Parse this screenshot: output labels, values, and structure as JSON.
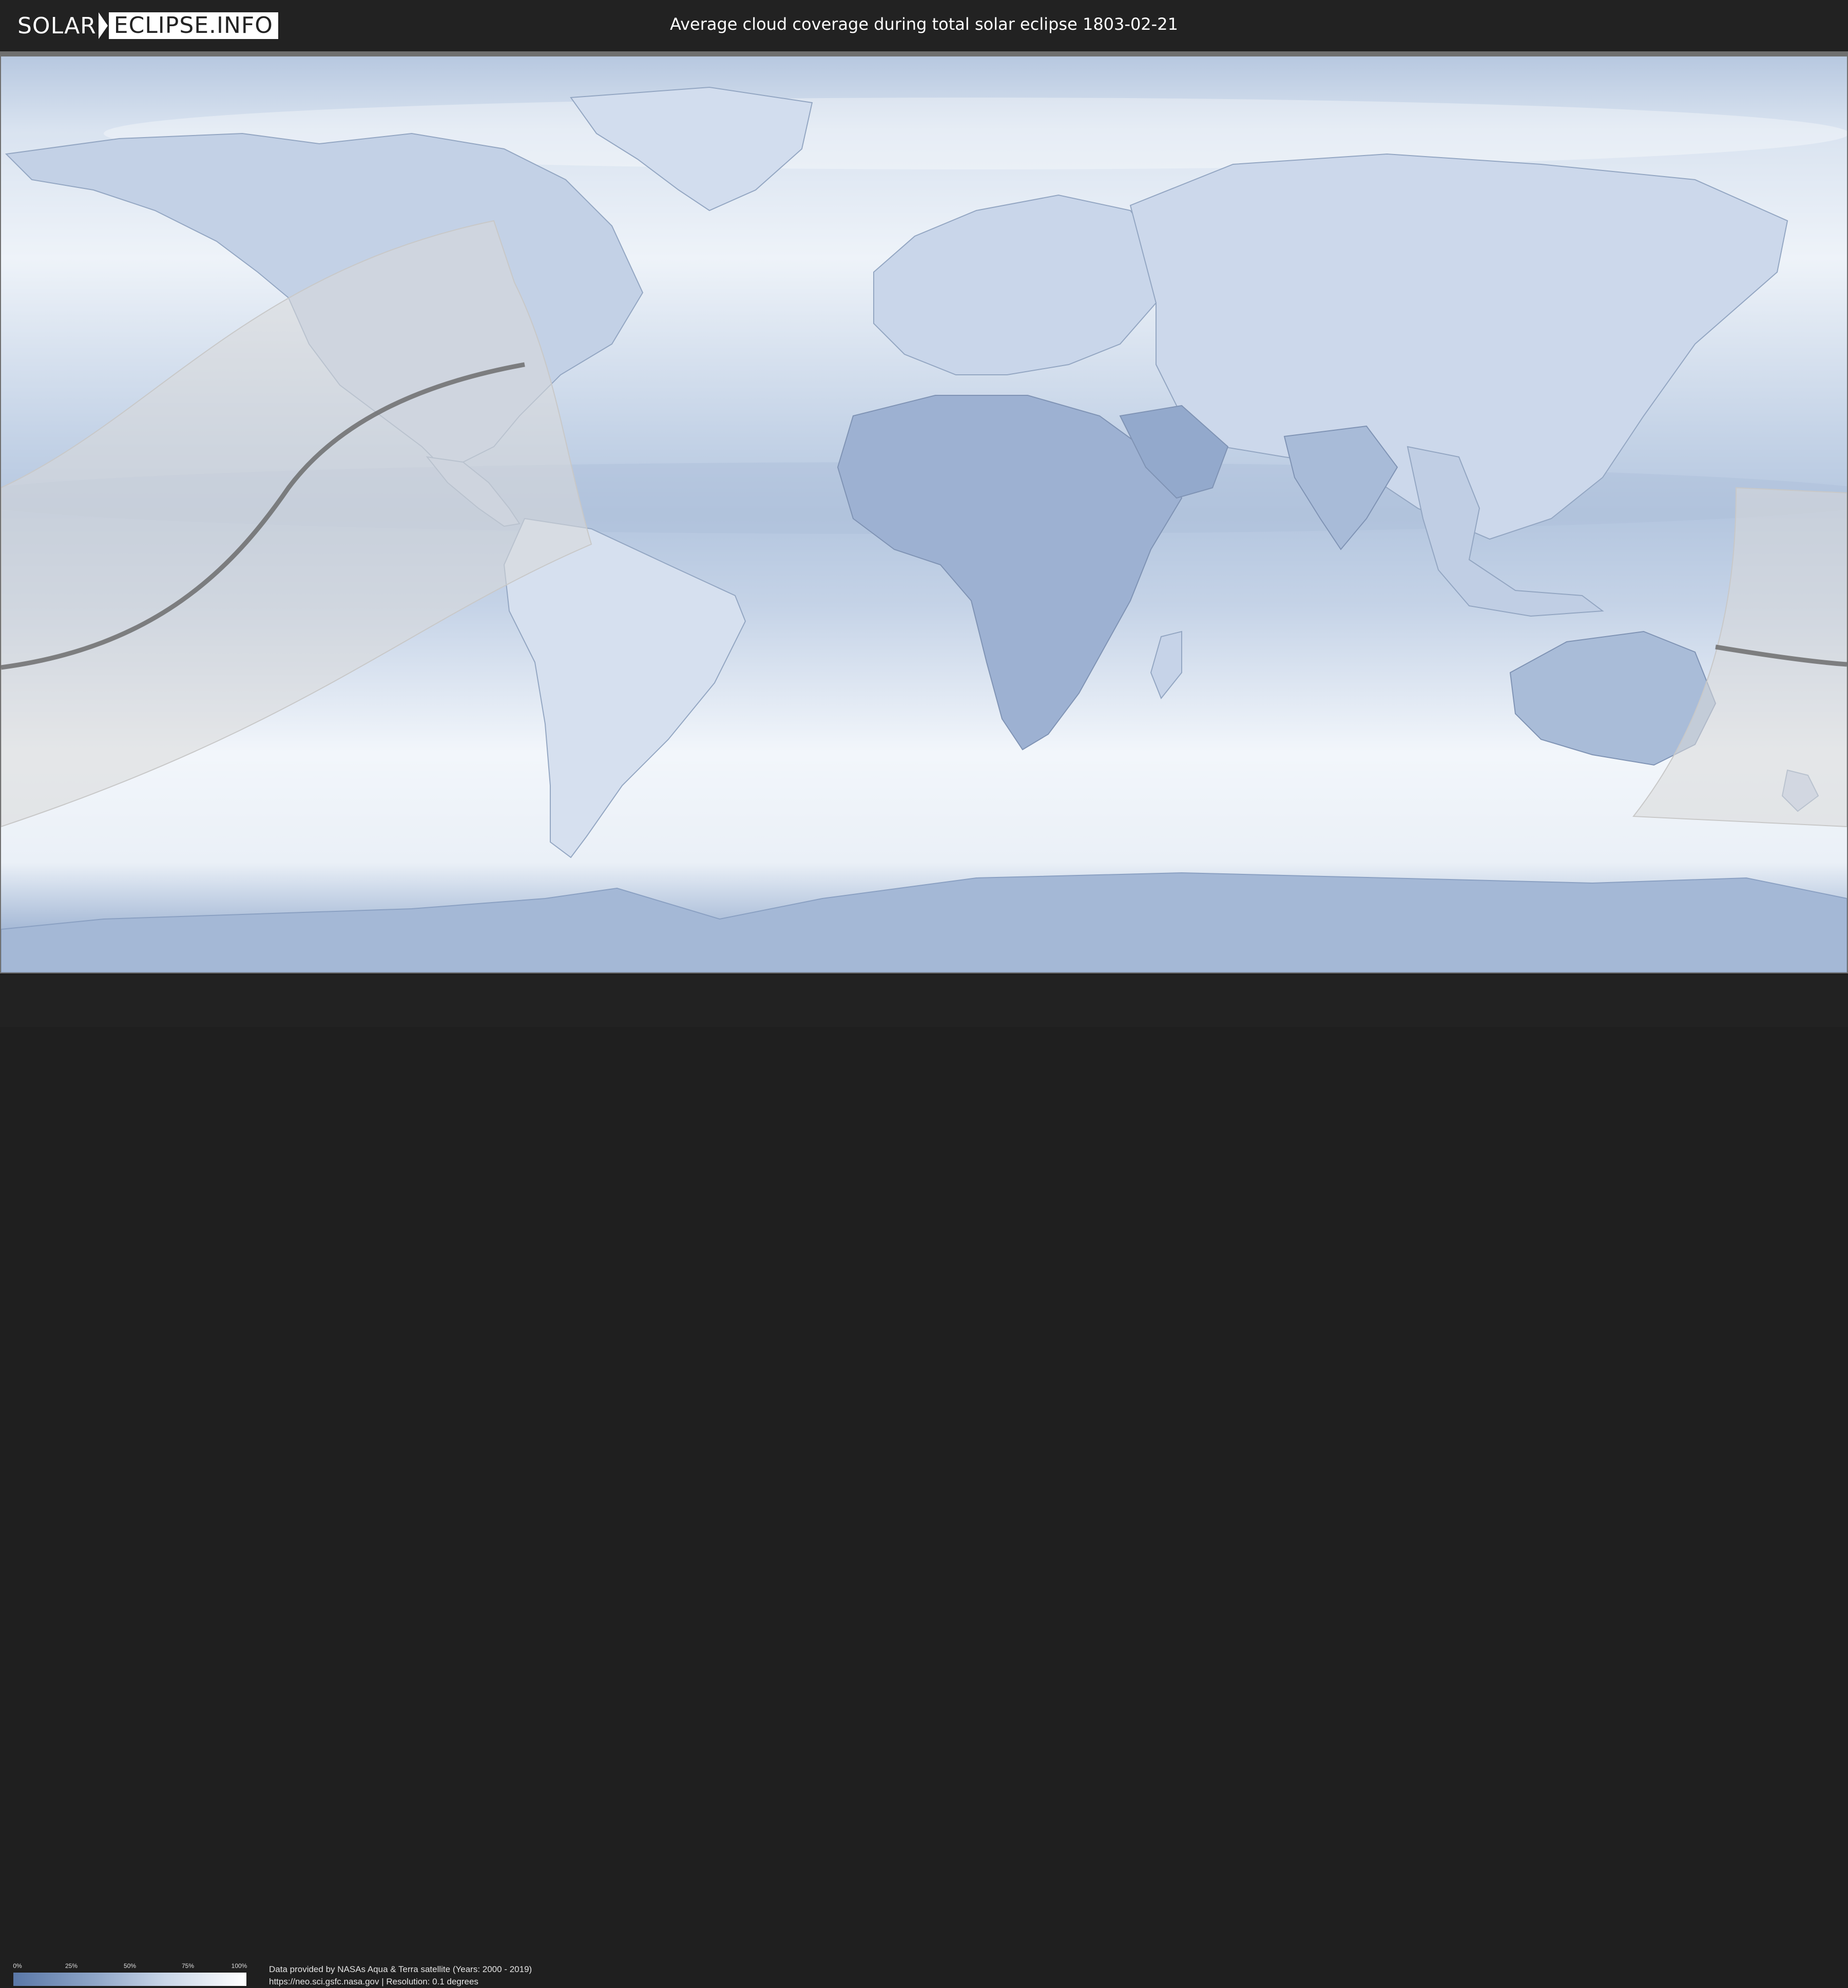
{
  "header": {
    "logo_left": "SOLAR",
    "logo_right": "ECLIPSE.INFO",
    "title": "Average cloud coverage during total solar eclipse 1803-02-21"
  },
  "colors": {
    "background": "#222222",
    "ocean_clear": "#ffffff",
    "cloud_low": "#5a78a8",
    "eclipse_zone": "#d8d8d8",
    "central_line": "#666666"
  },
  "map": {
    "type": "world cloud-coverage map",
    "projection": "equirectangular",
    "overlay": "total solar eclipse visibility zone with central line"
  },
  "legend": {
    "ticks": [
      "0%",
      "25%",
      "50%",
      "75%",
      "100%"
    ],
    "range": [
      0,
      100
    ]
  },
  "footer": {
    "credit_line_1": "Data provided by NASAs Aqua & Terra satellite (Years: 2000 - 2019)",
    "credit_line_2": "https://neo.sci.gsfc.nasa.gov | Resolution: 0.1 degrees"
  }
}
